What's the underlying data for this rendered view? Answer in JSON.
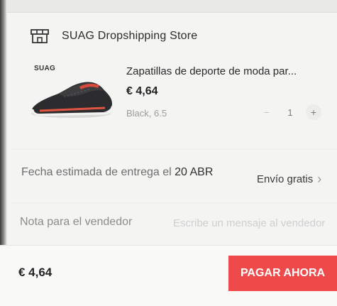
{
  "store": {
    "name": "SUAG Dropshipping Store",
    "icon": "store-icon"
  },
  "item": {
    "brand": "SUAG",
    "title": "Zapatillas de deporte de moda par...",
    "price": "€ 4,64",
    "variant": "Black, 6.5",
    "quantity": "1",
    "minus": "−",
    "plus": "+"
  },
  "delivery": {
    "prefix": "Fecha estimada de entrega el ",
    "date": "20 ABR",
    "shipping": "Envío gratis",
    "chevron": "›"
  },
  "note": {
    "label": "Nota para el vendedor",
    "placeholder": "Escribe un mensaje al vendedor"
  },
  "footer": {
    "total": "€ 4,64",
    "pay_label": "PAGAR AHORA"
  },
  "colors": {
    "pay_button": "#ef4a4a",
    "background": "#f4f4f2"
  }
}
